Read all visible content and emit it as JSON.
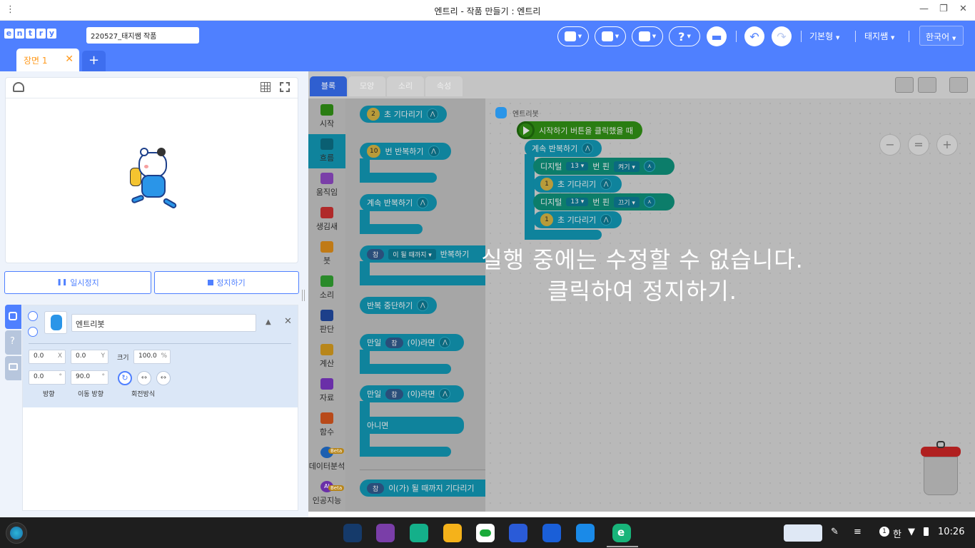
{
  "window": {
    "title": "엔트리 - 작품 만들기 : 엔트리"
  },
  "header": {
    "logo_letters": [
      "e",
      "n",
      "t",
      "r",
      "y"
    ],
    "project_name": "220527_태지쌤 작품",
    "mode": "기본형",
    "user": "태지쌤",
    "language": "한국어"
  },
  "scene": {
    "tab_label": "장면 1",
    "close": "✕",
    "add": "+"
  },
  "stage_controls": {
    "pause": "일시정지",
    "stop": "정지하기"
  },
  "object": {
    "name": "엔트리봇",
    "x": "0.0",
    "x_label": "X",
    "y": "0.0",
    "y_label": "Y",
    "size_label": "크기",
    "size": "100.0",
    "size_unit": "%",
    "direction": "0.0",
    "direction_label": "방향",
    "move_direction": "90.0",
    "move_direction_label": "이동 방향",
    "degree_unit": "°",
    "rotation_label": "회전방식"
  },
  "workspace": {
    "tabs": [
      "블록",
      "모양",
      "소리",
      "속성"
    ],
    "categories": [
      {
        "label": "시작",
        "color": "#2a7d12"
      },
      {
        "label": "흐름",
        "color": "#0f839c"
      },
      {
        "label": "움직임",
        "color": "#7a3ea8"
      },
      {
        "label": "생김새",
        "color": "#b02a2a"
      },
      {
        "label": "붓",
        "color": "#c07a16"
      },
      {
        "label": "소리",
        "color": "#2a8a2a"
      },
      {
        "label": "판단",
        "color": "#1c3f8a"
      },
      {
        "label": "계산",
        "color": "#b8861a"
      },
      {
        "label": "자료",
        "color": "#6a2fa8"
      },
      {
        "label": "함수",
        "color": "#b84a1a"
      },
      {
        "label": "데이터분석",
        "color": "#1c5fb0",
        "badge": "Beta"
      },
      {
        "label": "인공지능",
        "color": "#6a2fa8",
        "badge": "Beta",
        "short": "AI"
      }
    ],
    "palette": {
      "wait": {
        "num": "2",
        "text": "초 기다리기"
      },
      "repeat": {
        "num": "10",
        "text": "번 반복하기"
      },
      "forever": "계속 반복하기",
      "repeat_until": {
        "cond": "참",
        "drop": "이 될 때까지",
        "text": "반복하기"
      },
      "break": "반복 중단하기",
      "if": {
        "word": "만일",
        "cond": "참",
        "text": "(이)라면"
      },
      "ifelse": {
        "word": "만일",
        "cond": "참",
        "text": "(이)라면",
        "else": "아니면"
      },
      "wait_until": {
        "cond": "참",
        "text": "이(가) 될 때까지 기다리기"
      }
    },
    "script": {
      "object_label": "엔트리봇",
      "start": "시작하기 버튼을 클릭했을 때",
      "forever": "계속 반복하기",
      "digital1": {
        "a": "디지털",
        "pin": "13",
        "b": "번 핀",
        "state": "켜기"
      },
      "wait1": {
        "num": "1",
        "text": "초 기다리기"
      },
      "digital2": {
        "a": "디지털",
        "pin": "13",
        "b": "번 핀",
        "state": "끄기"
      },
      "wait2": {
        "num": "1",
        "text": "초 기다리기"
      }
    },
    "overlay": {
      "line1": "실행 중에는 수정할 수 없습니다.",
      "line2": "클릭하여 정지하기."
    },
    "zoom": {
      "out": "−",
      "reset": "=",
      "in": "+"
    }
  },
  "taskbar": {
    "ime": "한",
    "notif": "1",
    "time": "10:26"
  }
}
